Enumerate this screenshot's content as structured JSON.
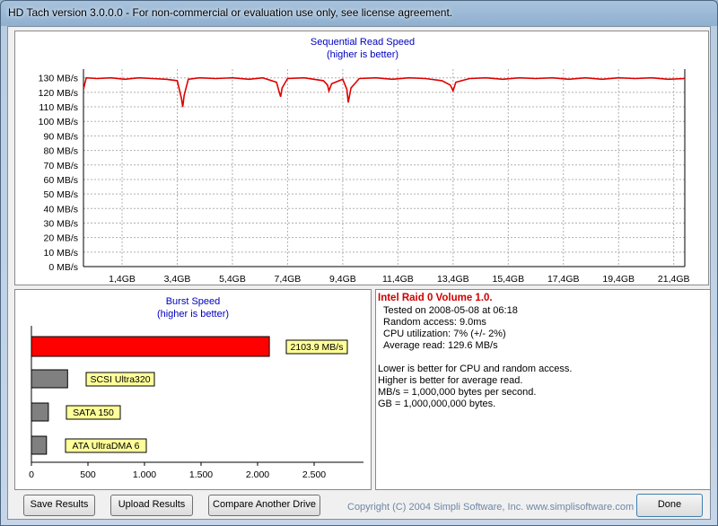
{
  "window": {
    "title": "HD Tach version 3.0.0.0  - For non-commercial or evaluation use only, see license agreement."
  },
  "read_chart": {
    "title": "Sequential Read Speed",
    "subtitle": "(higher is better)",
    "y_ticks": [
      "130 MB/s",
      "120 MB/s",
      "110 MB/s",
      "100 MB/s",
      "90 MB/s",
      "80 MB/s",
      "70 MB/s",
      "60 MB/s",
      "50 MB/s",
      "40 MB/s",
      "30 MB/s",
      "20 MB/s",
      "10 MB/s",
      "0 MB/s"
    ],
    "x_ticks": [
      "1,4GB",
      "3,4GB",
      "5,4GB",
      "7,4GB",
      "9,4GB",
      "11,4GB",
      "13,4GB",
      "15,4GB",
      "17,4GB",
      "19,4GB",
      "21,4GB"
    ],
    "line_color": "#e00000",
    "grid_color": "#b0b0b0"
  },
  "burst_chart": {
    "title": "Burst Speed",
    "subtitle": "(higher is better)",
    "x_ticks": [
      "0",
      "500",
      "1.000",
      "1.500",
      "2.000",
      "2.500"
    ]
  },
  "chart_data": [
    {
      "type": "line",
      "title": "Sequential Read Speed",
      "subtitle": "(higher is better)",
      "xlabel": "",
      "ylabel": "",
      "xlim": [
        0.0,
        21.8
      ],
      "ylim": [
        0,
        136
      ],
      "x_unit": "GB",
      "y_unit": "MB/s",
      "grid": true,
      "series": [
        {
          "color": "#e00000",
          "x": [
            0.0,
            0.1,
            0.5,
            1.0,
            1.5,
            2.0,
            2.5,
            3.0,
            3.4,
            3.55,
            3.6,
            3.65,
            3.8,
            4.2,
            4.8,
            5.4,
            6.0,
            6.5,
            7.0,
            7.1,
            7.15,
            7.2,
            7.4,
            8.0,
            8.7,
            8.85,
            8.9,
            9.0,
            9.4,
            9.55,
            9.6,
            9.7,
            10.0,
            10.6,
            11.2,
            11.8,
            12.4,
            13.0,
            13.3,
            13.4,
            13.5,
            14.0,
            14.6,
            15.2,
            15.8,
            16.4,
            17.0,
            17.6,
            18.2,
            18.8,
            19.4,
            20.0,
            20.6,
            21.2,
            21.8
          ],
          "y": [
            122,
            130,
            129.5,
            130,
            129,
            130,
            129.5,
            129,
            128,
            116,
            110,
            118,
            129,
            130,
            129.5,
            130,
            129,
            130,
            127,
            120,
            117,
            123,
            129.5,
            130,
            128,
            125,
            121,
            126,
            129,
            122,
            113,
            123,
            129.5,
            130,
            129,
            130,
            129.5,
            128,
            125,
            121,
            127,
            129.5,
            130,
            129,
            130,
            129.5,
            130,
            129,
            130,
            129,
            130,
            129.5,
            130,
            129,
            129.5
          ]
        }
      ]
    },
    {
      "type": "bar",
      "orientation": "horizontal",
      "title": "Burst Speed",
      "subtitle": "(higher is better)",
      "xlabel": "",
      "ylabel": "",
      "xlim": [
        0,
        2800
      ],
      "categories": [
        "2103.9 MB/s",
        "SCSI Ultra320",
        "SATA 150",
        "ATA UltraDMA 6"
      ],
      "values": [
        2103.9,
        320,
        150,
        133
      ],
      "bar_colors": [
        "#ff0000",
        "#808080",
        "#808080",
        "#808080"
      ],
      "label_bg": "#ffff99"
    }
  ],
  "info": {
    "drive_name": "Intel Raid 0 Volume 1.0.",
    "tested_on": "Tested on 2008-05-08 at 06:18",
    "random_access": "Random access: 9.0ms",
    "cpu": "CPU utilization: 7% (+/- 2%)",
    "average_read": "Average read: 129.6 MB/s",
    "notes": [
      "Lower is better for CPU and random access.",
      "Higher is better for average read.",
      "MB/s = 1,000,000 bytes per second.",
      "GB = 1,000,000,000 bytes."
    ]
  },
  "buttons": {
    "save": "Save Results",
    "upload": "Upload Results",
    "compare": "Compare Another Drive",
    "done": "Done"
  },
  "footer": {
    "copyright": "Copyright (C) 2004 Simpli Software, Inc. www.simplisoftware.com"
  }
}
